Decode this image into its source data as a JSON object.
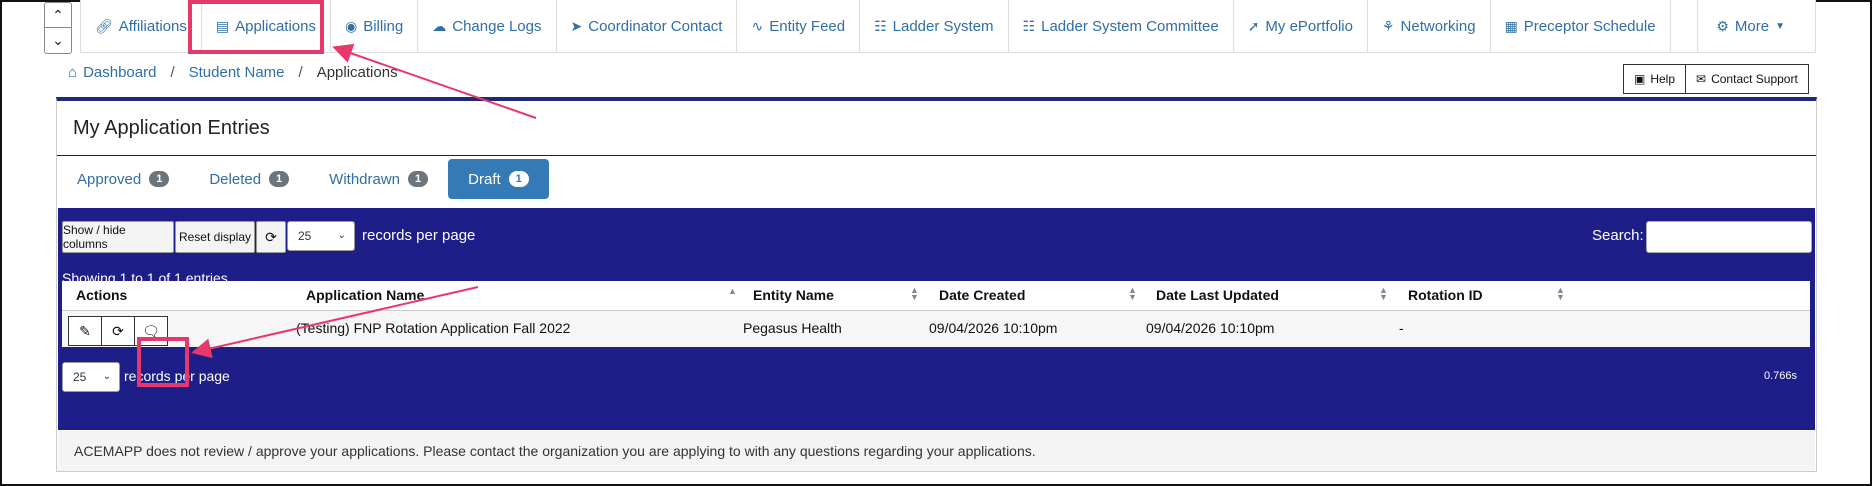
{
  "nav": {
    "tabs": [
      {
        "label": "Affiliations",
        "icon": "link-icon"
      },
      {
        "label": "Applications",
        "icon": "id-card-icon"
      },
      {
        "label": "Billing",
        "icon": "money-icon"
      },
      {
        "label": "Change Logs",
        "icon": "cloud-icon"
      },
      {
        "label": "Coordinator Contact",
        "icon": "paper-plane-icon"
      },
      {
        "label": "Entity Feed",
        "icon": "rss-icon"
      },
      {
        "label": "Ladder System",
        "icon": "ladder-icon"
      },
      {
        "label": "Ladder System Committee",
        "icon": "ladder-icon"
      },
      {
        "label": "My ePortfolio",
        "icon": "rocket-icon"
      },
      {
        "label": "Networking",
        "icon": "network-icon"
      },
      {
        "label": "Preceptor Schedule",
        "icon": "calendar-icon"
      }
    ],
    "more_label": "More",
    "highlight_color": "#e6386a"
  },
  "breadcrumb": {
    "home": "Dashboard",
    "middle": "Student Name",
    "current": "Applications"
  },
  "header_buttons": {
    "help": "Help",
    "contact": "Contact Support"
  },
  "panel": {
    "title": "My Application Entries",
    "status_tabs": [
      {
        "label": "Approved",
        "count": "1",
        "active": false
      },
      {
        "label": "Deleted",
        "count": "1",
        "active": false
      },
      {
        "label": "Withdrawn",
        "count": "1",
        "active": false
      },
      {
        "label": "Draft",
        "count": "1",
        "active": true
      }
    ]
  },
  "table": {
    "show_hide_label": "Show / hide columns",
    "reset_label": "Reset display",
    "per_page_value": "25",
    "per_page_label": "records per page",
    "search_label": "Search:",
    "showing": "Showing 1 to 1 of 1 entries",
    "columns": [
      "Actions",
      "Application Name",
      "Entity Name",
      "Date Created",
      "Date Last Updated",
      "Rotation ID"
    ],
    "rows": [
      {
        "application_name": "(Testing) FNP Rotation Application Fall 2022",
        "entity_name": "Pegasus Health",
        "date_created": "09/04/2026 10:10pm",
        "date_updated": "09/04/2026 10:10pm",
        "rotation_id": "-"
      }
    ],
    "timing": "0.766s",
    "accent_color": "#1e1e88"
  },
  "footer_note": "ACEMAPP does not review / approve your applications. Please contact the organization you are applying to with any questions regarding your applications."
}
